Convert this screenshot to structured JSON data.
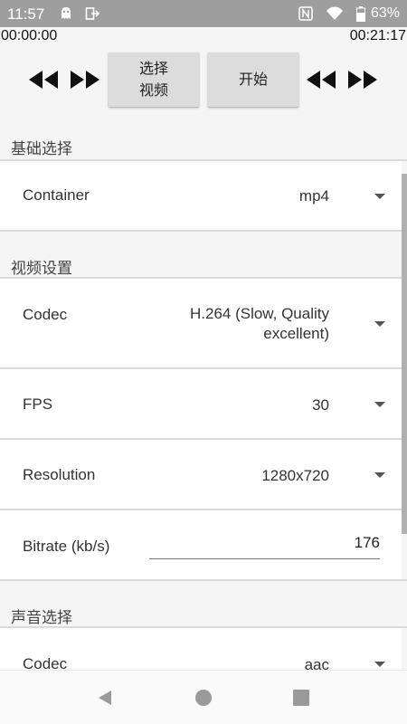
{
  "status_bar": {
    "time": "11:57",
    "battery": "63%",
    "icons": [
      "ghost-icon",
      "sign-out-icon",
      "nfc-icon",
      "wifi-icon",
      "battery-icon"
    ]
  },
  "player": {
    "current_time": "00:00:00",
    "total_time": "00:21:17",
    "select_video_label": "选择\n视频",
    "start_label": "开始"
  },
  "sections": {
    "basic": {
      "title": "基础选择"
    },
    "video": {
      "title": "视频设置"
    },
    "audio": {
      "title": "声音选择"
    }
  },
  "settings": {
    "container": {
      "label": "Container",
      "value": "mp4"
    },
    "video_codec": {
      "label": "Codec",
      "value": "H.264 (Slow, Quality\nexcellent)"
    },
    "fps": {
      "label": "FPS",
      "value": "30"
    },
    "resolution": {
      "label": "Resolution",
      "value": "1280x720"
    },
    "bitrate": {
      "label": "Bitrate (kb/s)",
      "value": "176"
    },
    "audio_codec": {
      "label": "Codec",
      "value": "aac"
    }
  },
  "colors": {
    "status_bar": "#9e9e9e",
    "background": "#f5f5f5",
    "button": "#dcdcdc",
    "row": "#ffffff"
  }
}
